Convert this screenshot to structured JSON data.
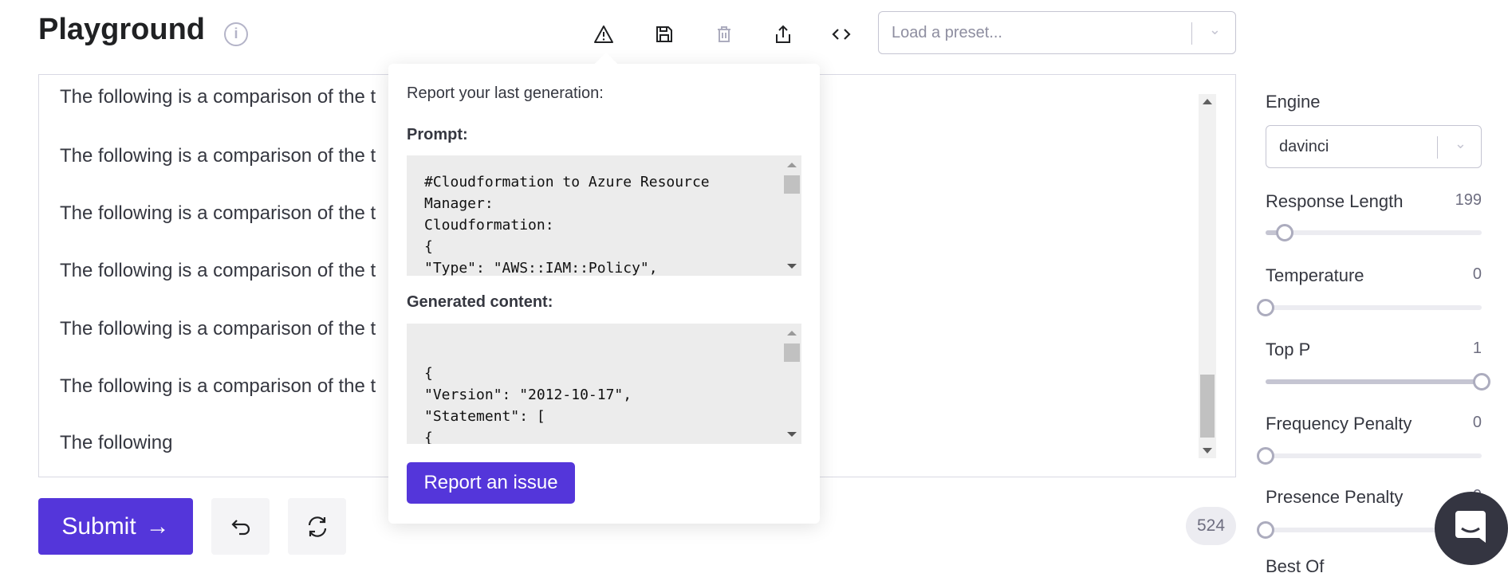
{
  "header": {
    "title": "Playground",
    "preset_placeholder": "Load a preset..."
  },
  "toolbar": {
    "icons": [
      "warning-icon",
      "save-icon",
      "trash-icon",
      "share-icon",
      "code-icon"
    ]
  },
  "editor": {
    "lines": [
      "The following is a comparison of the t",
      "The following is a comparison of the t",
      "The following is a comparison of the t",
      "The following is a comparison of the t",
      "The following is a comparison of the t",
      "The following is a comparison of the t",
      "The following"
    ]
  },
  "popup": {
    "heading": "Report your last generation:",
    "prompt_label": "Prompt:",
    "prompt_text": "#Cloudformation to Azure Resource\nManager:\nCloudformation:\n{\n\"Type\": \"AWS::IAM::Policy\",",
    "generated_label": "Generated content:",
    "generated_text": "\n{\n\"Version\": \"2012-10-17\",\n\"Statement\": [\n{",
    "report_button": "Report an issue"
  },
  "actions": {
    "submit": "Submit",
    "submit_arrow": "→",
    "token_count": "524"
  },
  "settings": {
    "engine_label": "Engine",
    "engine_value": "davinci",
    "sliders": [
      {
        "label": "Response Length",
        "value": "199",
        "fraction": 0.09
      },
      {
        "label": "Temperature",
        "value": "0",
        "fraction": 0
      },
      {
        "label": "Top P",
        "value": "1",
        "fraction": 1
      },
      {
        "label": "Frequency Penalty",
        "value": "0",
        "fraction": 0
      },
      {
        "label": "Presence Penalty",
        "value": "0",
        "fraction": 0
      }
    ],
    "next_label": "Best Of"
  },
  "colors": {
    "accent": "#5436da"
  }
}
